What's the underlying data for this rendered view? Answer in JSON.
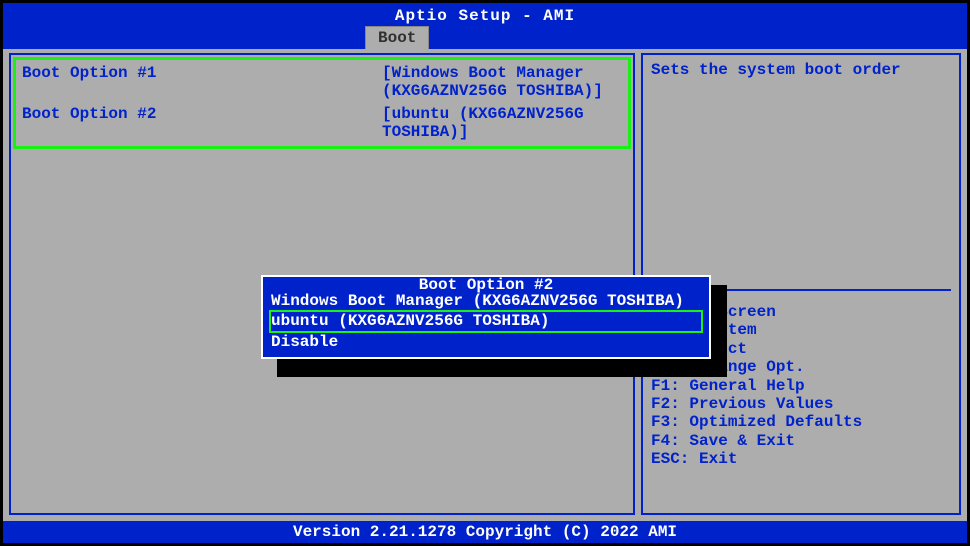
{
  "title": "Aptio Setup - AMI",
  "tab": "Boot",
  "boot_options": [
    {
      "label": "Boot Option #1",
      "value": "[Windows Boot Manager (KXG6AZNV256G TOSHIBA)]"
    },
    {
      "label": "Boot Option #2",
      "value": "[ubuntu (KXG6AZNV256G TOSHIBA)]"
    }
  ],
  "right": {
    "description": "Sets the system boot order",
    "help": [
      "    ct Screen",
      "    ct Item",
      "     elect",
      "+/-: Change Opt.",
      "F1: General Help",
      "F2: Previous Values",
      "F3: Optimized Defaults",
      "F4: Save & Exit",
      "ESC: Exit"
    ]
  },
  "popup": {
    "title": "Boot Option #2",
    "items": [
      "Windows Boot Manager (KXG6AZNV256G TOSHIBA)",
      "ubuntu (KXG6AZNV256G TOSHIBA)",
      "Disable"
    ],
    "selected_index": 1
  },
  "footer": "Version 2.21.1278 Copyright (C) 2022 AMI"
}
